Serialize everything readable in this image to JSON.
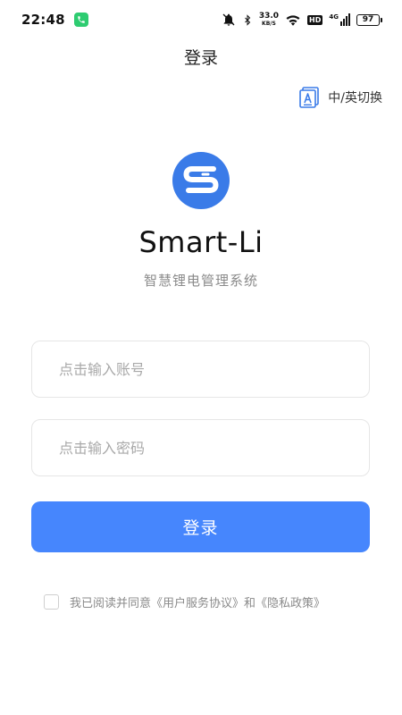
{
  "status_bar": {
    "time": "22:48",
    "net_speed_value": "33.0",
    "net_speed_unit": "KB/S",
    "hd_label": "HD",
    "network_type": "4G",
    "battery_level": "97"
  },
  "header": {
    "title": "登录",
    "lang_switch_label": "中/英切换"
  },
  "brand": {
    "app_name": "Smart-Li",
    "subtitle": "智慧锂电管理系统",
    "logo_color": "#3a7be8"
  },
  "form": {
    "account_placeholder": "点击输入账号",
    "account_value": "",
    "password_placeholder": "点击输入密码",
    "password_value": "",
    "submit_label": "登录",
    "submit_color": "#4686fd"
  },
  "agreement": {
    "checked": false,
    "prefix": "我已阅读并同意",
    "user_agreement": "《用户服务协议》",
    "conjunction": "和",
    "privacy_policy": "《隐私政策》"
  },
  "icons": [
    "phone-icon",
    "mute-bell-icon",
    "bluetooth-icon",
    "wifi-icon",
    "signal-icon",
    "battery-icon",
    "language-icon",
    "app-logo"
  ]
}
